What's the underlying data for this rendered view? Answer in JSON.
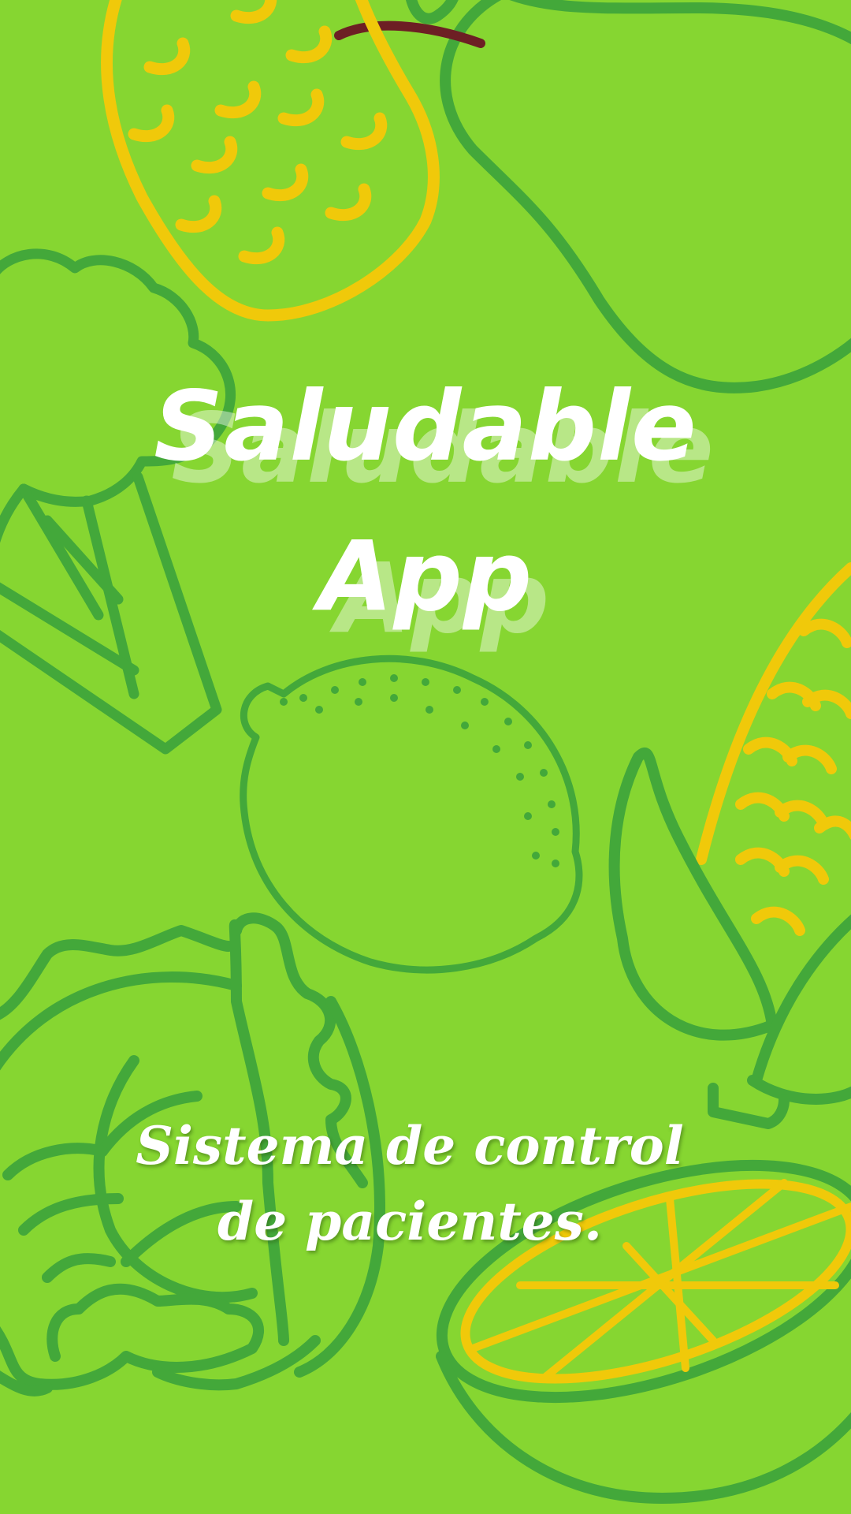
{
  "app": {
    "title_line1": "Saludable",
    "title_line2": "App",
    "subtitle": "Sistema de control de pacientes."
  },
  "colors": {
    "background": "#86d631",
    "outline_green": "#43a83a",
    "accent_yellow": "#f0c90a",
    "stem_brown": "#6d1f24",
    "text": "#ffffff"
  },
  "illustrations": [
    "pineapple-icon",
    "pear-icon",
    "broccoli-icon",
    "lemon-icon",
    "corn-icon",
    "lettuce-icon",
    "orange-slice-icon"
  ]
}
